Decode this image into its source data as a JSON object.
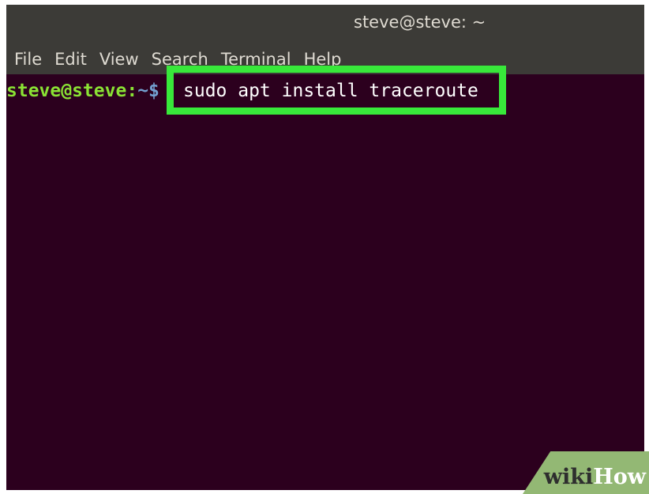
{
  "window": {
    "title": "steve@steve: ~"
  },
  "menubar": {
    "items": [
      {
        "label": "File"
      },
      {
        "label": "Edit"
      },
      {
        "label": "View"
      },
      {
        "label": "Search"
      },
      {
        "label": "Terminal"
      },
      {
        "label": "Help"
      }
    ]
  },
  "terminal": {
    "prompt_user_host": "steve@steve",
    "prompt_separator": ":",
    "prompt_path": "~",
    "prompt_symbol": "$",
    "command": "sudo apt install traceroute"
  },
  "colors": {
    "terminal_bg": "#2c001e",
    "prompt_user": "#8ae234",
    "prompt_path": "#729fcf",
    "highlight": "#38e83a"
  },
  "watermark": {
    "part1": "wiki",
    "part2": "How"
  }
}
